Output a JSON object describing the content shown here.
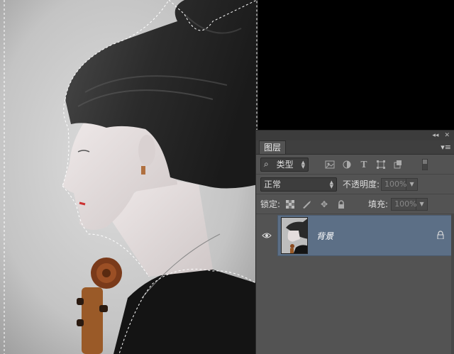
{
  "panel": {
    "topbar": {
      "collapse_icon": "◂◂",
      "close_icon": "✕"
    },
    "tab_label": "图层",
    "menu_icon": "▾≡",
    "filter": {
      "search_icon": "⌕",
      "kind_label": "类型"
    },
    "blend_mode": "正常",
    "opacity": {
      "label": "不透明度:",
      "value": "100%"
    },
    "lock": {
      "label": "锁定:"
    },
    "fill": {
      "label": "填充:",
      "value": "100%"
    },
    "layers": [
      {
        "name": "背景",
        "visible": true,
        "locked": true
      }
    ]
  },
  "colors": {
    "panel_bg": "#535353",
    "selected_layer": "#5c6f86",
    "canvas_bg": "#000000"
  }
}
